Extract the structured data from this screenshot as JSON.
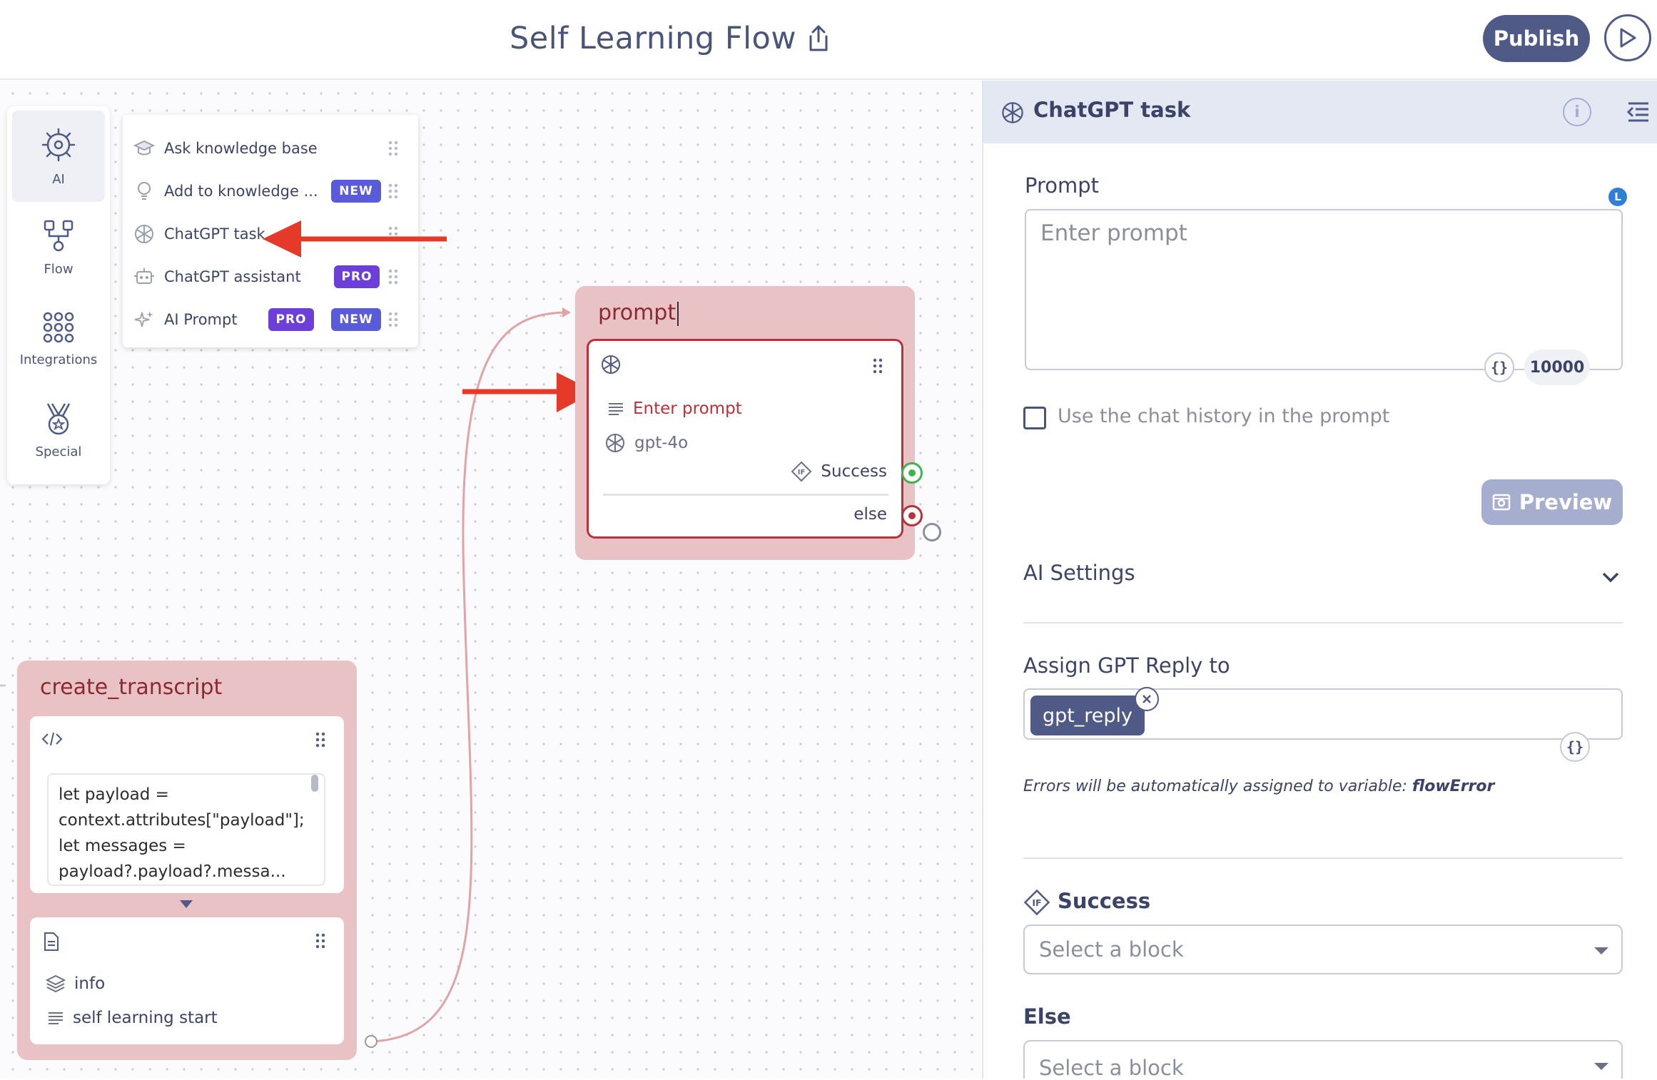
{
  "header": {
    "title": "Self Learning Flow",
    "publish_label": "Publish"
  },
  "sidebar": {
    "items": [
      {
        "label": "AI",
        "icon": "ai-brain-icon"
      },
      {
        "label": "Flow",
        "icon": "flow-icon"
      },
      {
        "label": "Integrations",
        "icon": "integrations-grid-icon"
      },
      {
        "label": "Special",
        "icon": "medal-icon"
      }
    ]
  },
  "ai_menu": {
    "items": [
      {
        "label": "Ask knowledge base",
        "icon": "graduation-cap-icon"
      },
      {
        "label": "Add to knowledge ...",
        "icon": "lightbulb-icon",
        "badges": [
          "NEW"
        ]
      },
      {
        "label": "ChatGPT task",
        "icon": "openai-icon"
      },
      {
        "label": "ChatGPT assistant",
        "icon": "robot-icon",
        "badges": [
          "PRO"
        ]
      },
      {
        "label": "AI Prompt",
        "icon": "sparkles-icon",
        "badges": [
          "PRO",
          "NEW"
        ]
      }
    ],
    "badge_new": "NEW",
    "badge_pro": "PRO"
  },
  "prompt_block": {
    "title": "prompt",
    "prompt_text": "Enter prompt",
    "model": "gpt-4o",
    "success_label": "Success",
    "else_label": "else"
  },
  "transcript_block": {
    "title": "create_transcript",
    "code": "let payload =\ncontext.attributes[\"payload\"];\nlet messages =\npayload?.payload?.messa...",
    "info_label": "info",
    "text_label": "self learning start"
  },
  "panel": {
    "title": "ChatGPT task",
    "prompt_label": "Prompt",
    "prompt_placeholder": "Enter prompt",
    "char_limit": "10000",
    "chat_history_label": "Use the chat history in the prompt",
    "preview_label": "Preview",
    "ai_settings_label": "AI Settings",
    "assign_label": "Assign GPT Reply to",
    "assigned_variable": "gpt_reply",
    "errors_note": "Errors will be automatically assigned to variable: ",
    "errors_variable": "flowError",
    "success_label": "Success",
    "else_label": "Else",
    "select_placeholder": "Select a block"
  },
  "colors": {
    "accent": "#4f5b86",
    "block_bg": "#e8c2c5",
    "block_border": "#b8323a",
    "success_port": "#3fb34f",
    "arrow": "#e53a2a",
    "badge_new": "#5a5bd9",
    "badge_pro": "#6b3fd8"
  }
}
